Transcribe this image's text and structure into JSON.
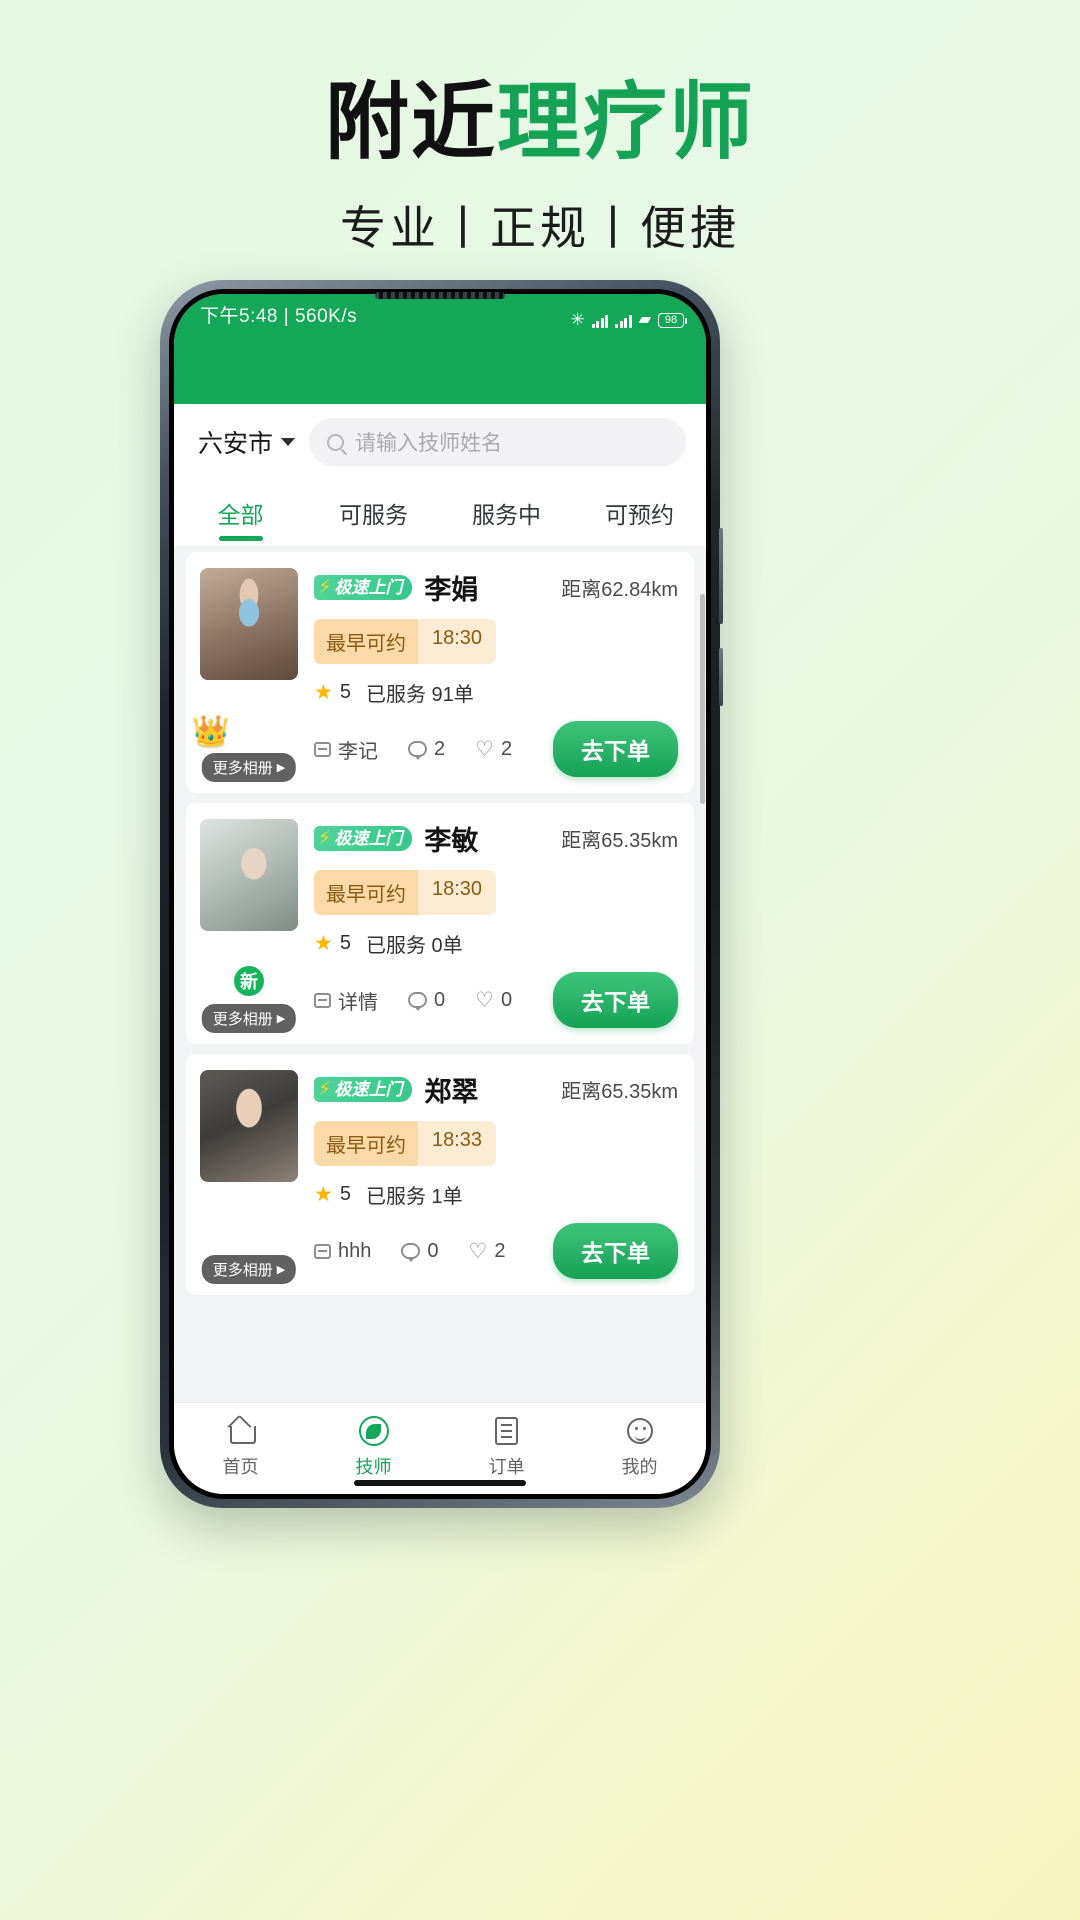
{
  "poster": {
    "headline_black": "附近",
    "headline_green": "理疗师",
    "subtitle": "专业丨正规丨便捷",
    "accent_color": "#15a254"
  },
  "status_bar": {
    "time_and_speed": "下午5:48 | 560K/s",
    "bluetooth_icon": "bluetooth-icon",
    "signal_icon": "signal-bars-icon",
    "wifi_icon": "wifi-icon",
    "battery_level": "98"
  },
  "header": {
    "city": "六安市",
    "city_caret_icon": "chevron-down-icon",
    "search_placeholder": "请输入技师姓名",
    "search_value": "",
    "search_icon": "search-icon",
    "brand_color": "#14a757"
  },
  "tabs": [
    {
      "label": "全部",
      "active": true
    },
    {
      "label": "可服务",
      "active": false
    },
    {
      "label": "服务中",
      "active": false
    },
    {
      "label": "可预约",
      "active": false
    }
  ],
  "cards": [
    {
      "badge": "极速上门",
      "name": "李娟",
      "distance": "距离62.84km",
      "earliest_label": "最早可约",
      "earliest_time": "18:30",
      "rating": "5",
      "served": "已服务 91单",
      "shop": "李记",
      "comments": "2",
      "likes": "2",
      "order_button": "去下单",
      "more_album": "更多相册",
      "decor": "crown"
    },
    {
      "badge": "极速上门",
      "name": "李敏",
      "distance": "距离65.35km",
      "earliest_label": "最早可约",
      "earliest_time": "18:30",
      "rating": "5",
      "served": "已服务 0单",
      "shop": "详情",
      "comments": "0",
      "likes": "0",
      "order_button": "去下单",
      "more_album": "更多相册",
      "decor": "新"
    },
    {
      "badge": "极速上门",
      "name": "郑翠",
      "distance": "距离65.35km",
      "earliest_label": "最早可约",
      "earliest_time": "18:33",
      "rating": "5",
      "served": "已服务 1单",
      "shop": "hhh",
      "comments": "0",
      "likes": "2",
      "order_button": "去下单",
      "more_album": "更多相册",
      "decor": "none"
    }
  ],
  "bottom_nav": [
    {
      "label": "首页",
      "icon": "home-icon",
      "active": false
    },
    {
      "label": "技师",
      "icon": "leaf-icon",
      "active": true
    },
    {
      "label": "订单",
      "icon": "order-icon",
      "active": false
    },
    {
      "label": "我的",
      "icon": "profile-icon",
      "active": false
    }
  ]
}
